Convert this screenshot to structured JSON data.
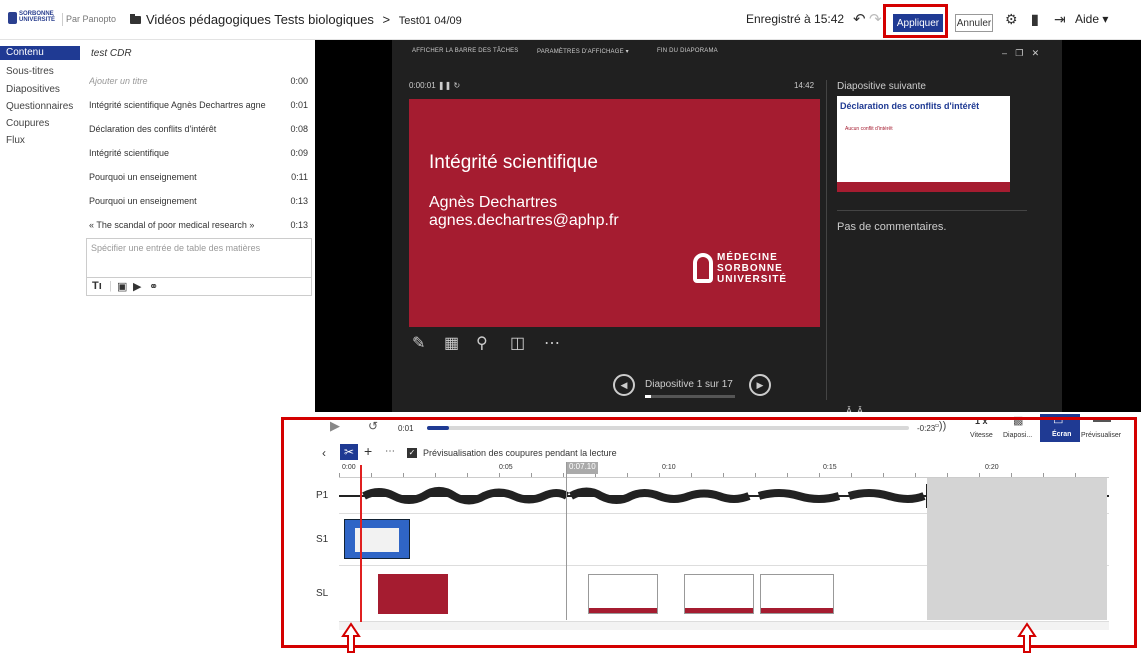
{
  "header": {
    "logo_line1": "SORBONNE",
    "logo_line2": "UNIVERSITÉ",
    "by": "Par Panopto",
    "folder": "Vidéos pédagogiques Tests biologiques",
    "separator": ">",
    "session": "Test01 04/09",
    "saved": "Enregistré à 15:42",
    "apply": "Appliquer",
    "cancel": "Annuler",
    "help": "Aide"
  },
  "nav": {
    "items": [
      "Contenu",
      "Sous-titres",
      "Diapositives",
      "Questionnaires",
      "Coupures",
      "Flux"
    ]
  },
  "toc": {
    "title": "test CDR",
    "rows": [
      {
        "label": "Ajouter un titre",
        "time": "0:00"
      },
      {
        "label": "Intégrité scientifique  Agnès Dechartres agne",
        "time": "0:01"
      },
      {
        "label": "Déclaration des conflits d'intérêt",
        "time": "0:08"
      },
      {
        "label": "Intégrité scientifique",
        "time": "0:09"
      },
      {
        "label": "Pourquoi un enseignement",
        "time": "0:11"
      },
      {
        "label": "Pourquoi un enseignement",
        "time": "0:13"
      },
      {
        "label": "« The scandal of poor medical research »",
        "time": "0:13"
      }
    ],
    "input_placeholder": "Spécifier une entrée de table des matières"
  },
  "player": {
    "toolbar": [
      "AFFICHER LA BARRE DES TÂCHES",
      "PARAMÈTRES D'AFFICHAGE ▾",
      "FIN DU DIAPORAMA"
    ],
    "elapsed": "0:00:01",
    "clock": "14:42",
    "slide": {
      "title": "Intégrité scientifique",
      "name": "Agnès Dechartres",
      "email": "agnes.dechartres@aphp.fr",
      "logo_lines": [
        "MÉDECINE",
        "SORBONNE",
        "UNIVERSITÉ"
      ]
    },
    "slide_counter": "Diapositive 1 sur 17",
    "next_label": "Diapositive suivante",
    "next_title": "Déclaration des conflits d'intérêt",
    "next_sub": "Aucun conflit d'intérêt",
    "comments": "Pas de commentaires."
  },
  "editor": {
    "current_time": "0:01",
    "remaining": "-0:23",
    "speed_value": "1 x",
    "speed_label": "Vitesse",
    "view_slides": "Diaposi...",
    "view_screen": "Écran",
    "view_preview": "Prévisualiser",
    "preview_cuts": "Prévisualisation des coupures pendant la lecture",
    "ruler": [
      "0:00",
      "0:05",
      "0:07.10",
      "0:10",
      "0:15",
      "0:20"
    ],
    "tracks": [
      "P1",
      "S1",
      "SL"
    ]
  },
  "colors": {
    "accent": "#1f3a93",
    "slide_red": "#a51c30",
    "annotation_red": "#d40000"
  }
}
